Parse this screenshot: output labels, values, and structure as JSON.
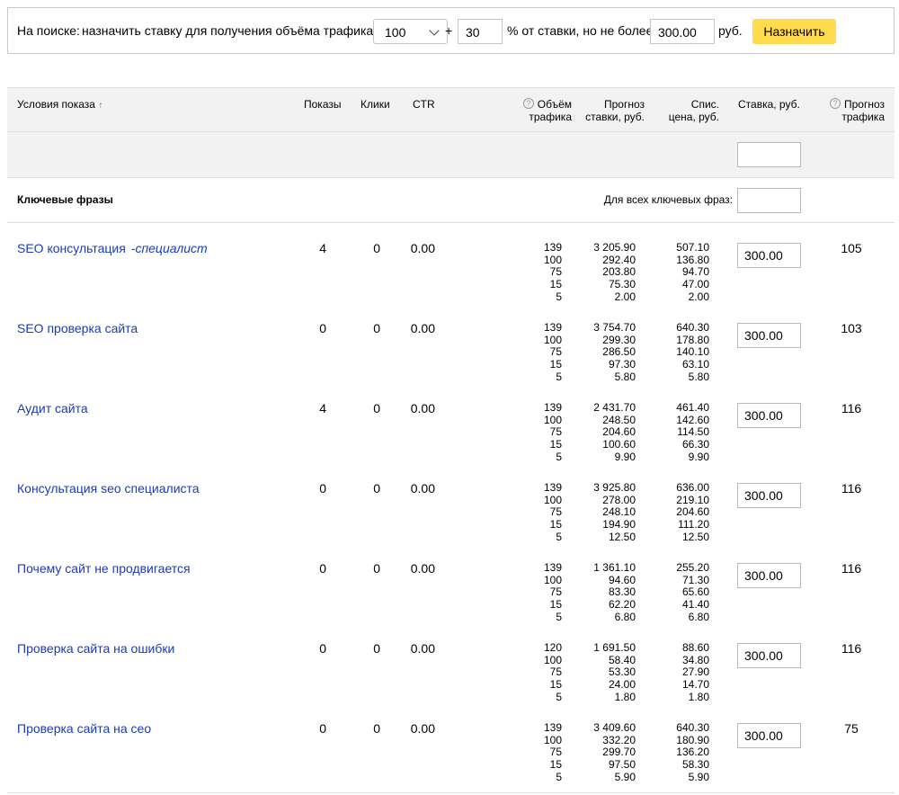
{
  "bidbar": {
    "label_prefix": "На поиске:",
    "label_assign": "назначить ставку для получения объёма трафика",
    "traffic_select": "100",
    "plus": "+",
    "percent_value": "30",
    "percent_label": "% от ставки, но не более",
    "max_value": "300.00",
    "currency": "руб.",
    "assign_button": "Назначить"
  },
  "header": {
    "conditions": "Условия показа",
    "sort_arrow": "↑",
    "impressions": "Показы",
    "clicks": "Клики",
    "ctr": "CTR",
    "traffic_volume_1": "Объём",
    "traffic_volume_2": "трафика",
    "forecast_bid_1": "Прогноз",
    "forecast_bid_2": "ставки, руб.",
    "charged_price_1": "Спис.",
    "charged_price_2": "цена, руб.",
    "bid": "Ставка, руб.",
    "forecast_traffic_1": "Прогноз",
    "forecast_traffic_2": "трафика",
    "help_glyph": "?"
  },
  "filter_row": {
    "bid_value": ""
  },
  "group": {
    "title": "Ключевые фразы",
    "for_all_label": "Для всех ключевых фраз:",
    "for_all_value": ""
  },
  "rows": [
    {
      "keyword": "SEO консультация",
      "minus": "-специалист",
      "impressions": "4",
      "clicks": "0",
      "ctr": "0.00",
      "volumes": [
        "139",
        "100",
        "75",
        "15",
        "5"
      ],
      "forecast_bids": [
        "3 205.90",
        "292.40",
        "203.80",
        "75.30",
        "2.00"
      ],
      "charged": [
        "507.10",
        "136.80",
        "94.70",
        "47.00",
        "2.00"
      ],
      "bid": "300.00",
      "forecast_traffic": "105"
    },
    {
      "keyword": "SEO проверка сайта",
      "minus": "",
      "impressions": "0",
      "clicks": "0",
      "ctr": "0.00",
      "volumes": [
        "139",
        "100",
        "75",
        "15",
        "5"
      ],
      "forecast_bids": [
        "3 754.70",
        "299.30",
        "286.50",
        "97.30",
        "5.80"
      ],
      "charged": [
        "640.30",
        "178.80",
        "140.10",
        "63.10",
        "5.80"
      ],
      "bid": "300.00",
      "forecast_traffic": "103"
    },
    {
      "keyword": "Аудит сайта",
      "minus": "",
      "impressions": "4",
      "clicks": "0",
      "ctr": "0.00",
      "volumes": [
        "139",
        "100",
        "75",
        "15",
        "5"
      ],
      "forecast_bids": [
        "2 431.70",
        "248.50",
        "204.60",
        "100.60",
        "9.90"
      ],
      "charged": [
        "461.40",
        "142.60",
        "114.50",
        "66.30",
        "9.90"
      ],
      "bid": "300.00",
      "forecast_traffic": "116"
    },
    {
      "keyword": "Консультация seo специалиста",
      "minus": "",
      "impressions": "0",
      "clicks": "0",
      "ctr": "0.00",
      "volumes": [
        "139",
        "100",
        "75",
        "15",
        "5"
      ],
      "forecast_bids": [
        "3 925.80",
        "278.00",
        "248.10",
        "194.90",
        "12.50"
      ],
      "charged": [
        "636.00",
        "219.10",
        "204.60",
        "111.20",
        "12.50"
      ],
      "bid": "300.00",
      "forecast_traffic": "116"
    },
    {
      "keyword": "Почему сайт не продвигается",
      "minus": "",
      "impressions": "0",
      "clicks": "0",
      "ctr": "0.00",
      "volumes": [
        "139",
        "100",
        "75",
        "15",
        "5"
      ],
      "forecast_bids": [
        "1 361.10",
        "94.60",
        "83.30",
        "62.20",
        "6.80"
      ],
      "charged": [
        "255.20",
        "71.30",
        "65.60",
        "41.40",
        "6.80"
      ],
      "bid": "300.00",
      "forecast_traffic": "116"
    },
    {
      "keyword": "Проверка сайта на ошибки",
      "minus": "",
      "impressions": "0",
      "clicks": "0",
      "ctr": "0.00",
      "volumes": [
        "120",
        "100",
        "75",
        "15",
        "5"
      ],
      "forecast_bids": [
        "1 691.50",
        "58.40",
        "53.30",
        "24.00",
        "1.80"
      ],
      "charged": [
        "88.60",
        "34.80",
        "27.90",
        "14.70",
        "1.80"
      ],
      "bid": "300.00",
      "forecast_traffic": "116"
    },
    {
      "keyword": "Проверка сайта на сео",
      "minus": "",
      "impressions": "0",
      "clicks": "0",
      "ctr": "0.00",
      "volumes": [
        "139",
        "100",
        "75",
        "15",
        "5"
      ],
      "forecast_bids": [
        "3 409.60",
        "332.20",
        "299.70",
        "97.50",
        "5.90"
      ],
      "charged": [
        "640.30",
        "180.90",
        "136.20",
        "58.30",
        "5.90"
      ],
      "bid": "300.00",
      "forecast_traffic": "75"
    }
  ]
}
